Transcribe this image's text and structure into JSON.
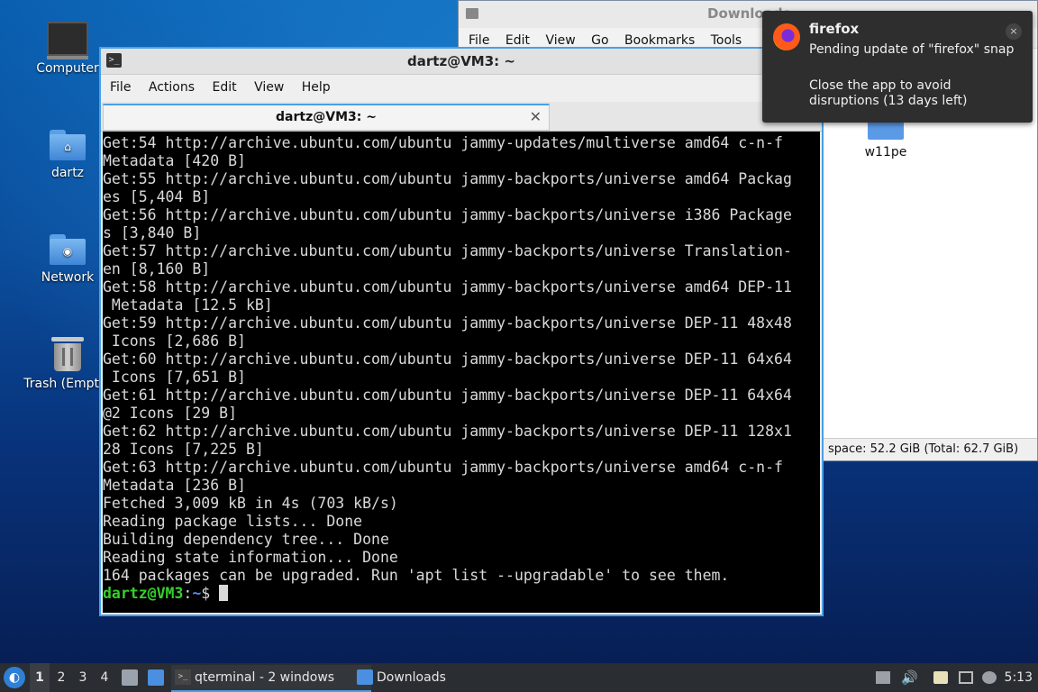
{
  "desktop": {
    "icons": [
      {
        "label": "Computer",
        "icon": "computer-icon"
      },
      {
        "label": "dartz",
        "icon": "home-folder-icon"
      },
      {
        "label": "Network",
        "icon": "network-folder-icon"
      },
      {
        "label": "Trash (Empty)",
        "icon": "trash-icon"
      }
    ]
  },
  "file_manager": {
    "title": "Downloads",
    "menu": [
      "File",
      "Edit",
      "View",
      "Go",
      "Bookmarks",
      "Tools"
    ],
    "folder_label": "w11pe",
    "status": "space: 52.2 GiB (Total: 62.7 GiB)"
  },
  "terminal": {
    "window_title": "dartz@VM3: ~",
    "menu": [
      "File",
      "Actions",
      "Edit",
      "View",
      "Help"
    ],
    "tab_title": "dartz@VM3: ~",
    "lines": [
      "Get:54 http://archive.ubuntu.com/ubuntu jammy-updates/multiverse amd64 c-n-f",
      "Metadata [420 B]",
      "Get:55 http://archive.ubuntu.com/ubuntu jammy-backports/universe amd64 Packag",
      "es [5,404 B]",
      "Get:56 http://archive.ubuntu.com/ubuntu jammy-backports/universe i386 Package",
      "s [3,840 B]",
      "Get:57 http://archive.ubuntu.com/ubuntu jammy-backports/universe Translation-",
      "en [8,160 B]",
      "Get:58 http://archive.ubuntu.com/ubuntu jammy-backports/universe amd64 DEP-11",
      " Metadata [12.5 kB]",
      "Get:59 http://archive.ubuntu.com/ubuntu jammy-backports/universe DEP-11 48x48",
      " Icons [2,686 B]",
      "Get:60 http://archive.ubuntu.com/ubuntu jammy-backports/universe DEP-11 64x64",
      " Icons [7,651 B]",
      "Get:61 http://archive.ubuntu.com/ubuntu jammy-backports/universe DEP-11 64x64",
      "@2 Icons [29 B]",
      "Get:62 http://archive.ubuntu.com/ubuntu jammy-backports/universe DEP-11 128x1",
      "28 Icons [7,225 B]",
      "Get:63 http://archive.ubuntu.com/ubuntu jammy-backports/universe amd64 c-n-f",
      "Metadata [236 B]",
      "Fetched 3,009 kB in 4s (703 kB/s)",
      "Reading package lists... Done",
      "Building dependency tree... Done",
      "Reading state information... Done",
      "164 packages can be upgraded. Run 'apt list --upgradable' to see them."
    ],
    "prompt_user": "dartz@VM3",
    "prompt_sep": ":",
    "prompt_path": "~",
    "prompt_symbol": "$ "
  },
  "notification": {
    "app": "firefox",
    "line1": "Pending update of \"firefox\" snap",
    "line2": "Close the app to avoid disruptions (13 days left)",
    "close_label": "×"
  },
  "taskbar": {
    "workspaces": [
      "1",
      "2",
      "3",
      "4"
    ],
    "active_workspace": "1",
    "tasks": [
      {
        "label": "qterminal - 2 windows",
        "icon": "terminal-icon"
      },
      {
        "label": "Downloads",
        "icon": "folder-icon"
      }
    ],
    "clock": "5:13"
  }
}
